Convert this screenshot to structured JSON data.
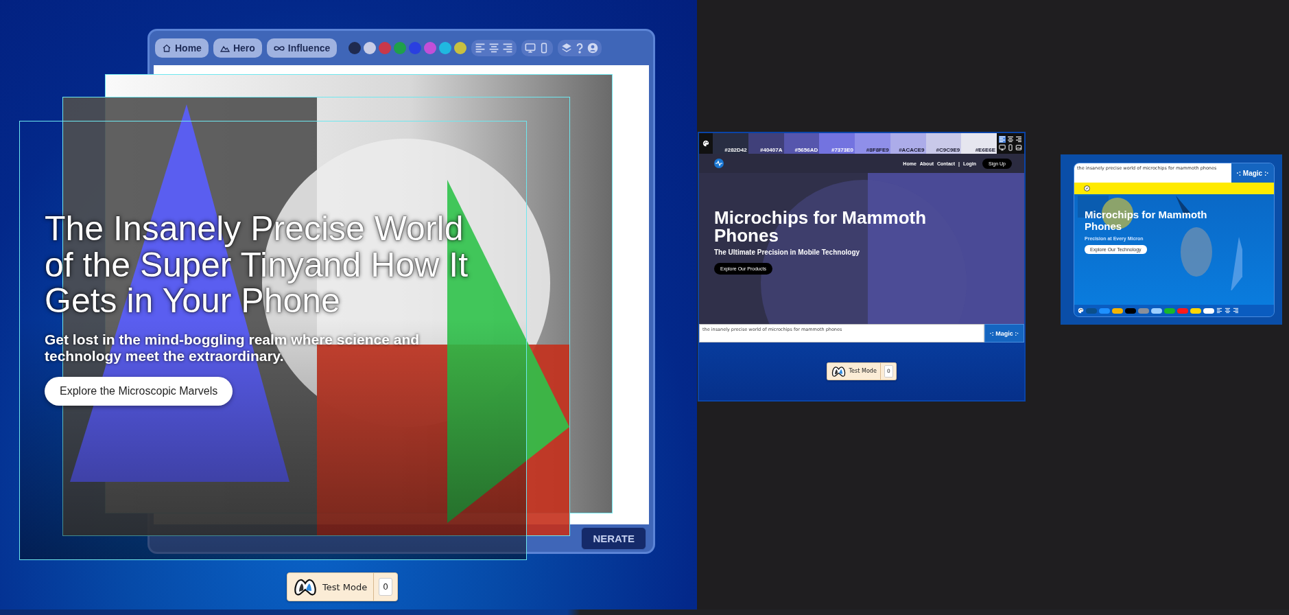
{
  "studio": {
    "tabs": [
      {
        "label": "Home",
        "selected": false
      },
      {
        "label": "Hero",
        "selected": false
      },
      {
        "label": "Influence",
        "selected": false
      }
    ],
    "colors": [
      {
        "color": "#1f2a4f"
      },
      {
        "color": "#c9cde6"
      },
      {
        "color": "#c8384a"
      },
      {
        "color": "#1fa04a"
      },
      {
        "color": "#2a3fe0"
      },
      {
        "color": "#c24fd8"
      },
      {
        "color": "#20b8e0"
      },
      {
        "color": "#c8c040"
      }
    ],
    "generate_button": "NERATE",
    "hero": {
      "title": "The Insanely Precise World of the Super Tinyand How It Gets in Your Phone",
      "subtitle": "Get lost in the mind-boggling realm where science and technology meet the extraordinary.",
      "button": "Explore the Microscopic Marvels"
    },
    "test_mode": {
      "label": "Test Mode",
      "count": "0"
    }
  },
  "desktop_preview": {
    "palette": [
      {
        "label": "#282D42",
        "color": "#282d42"
      },
      {
        "label": "#40407A",
        "color": "#40407a"
      },
      {
        "label": "#5656AD",
        "color": "#5656ad"
      },
      {
        "label": "#7373E0",
        "color": "#7373e0"
      },
      {
        "label": "#8F8FE9",
        "color": "#8f8fe9"
      },
      {
        "label": "#ACACE9",
        "color": "#acace9"
      },
      {
        "label": "#C9C9E9",
        "color": "#c9c9e9"
      },
      {
        "label": "#E6E6E",
        "color": "#e6e6ef"
      }
    ],
    "nav": {
      "links": [
        "Home",
        "About",
        "Contact"
      ],
      "separator": "|",
      "login": "Login",
      "signup": "Sign Up"
    },
    "hero": {
      "title": "Microchips for Mammoth Phones",
      "subtitle": "The Ultimate Precision in Mobile Technology",
      "button": "Explore Our Products"
    },
    "prompt": {
      "value": "the insanely precise world of microchips for mammoth phones",
      "button": "·: Magic :·"
    },
    "test_mode": {
      "label": "Test Mode",
      "count": "0"
    }
  },
  "mobile_preview": {
    "prompt": {
      "value": "the insanely precise world of microchips for mammoth phones",
      "button": "·: Magic :·"
    },
    "hero": {
      "title": "Microchips for Mammoth Phones",
      "subtitle": "Precision at Every Micron",
      "button": "Explore Our Technology"
    },
    "colors": [
      {
        "color": "#0b4f8a"
      },
      {
        "color": "#1e90ff"
      },
      {
        "color": "#f4b400"
      },
      {
        "color": "#000000"
      },
      {
        "color": "#8a8f9a"
      },
      {
        "color": "#9ccfff"
      },
      {
        "color": "#19b82a"
      },
      {
        "color": "#ff1a1a"
      },
      {
        "color": "#ffd600"
      },
      {
        "color": "#ffffff"
      }
    ]
  }
}
